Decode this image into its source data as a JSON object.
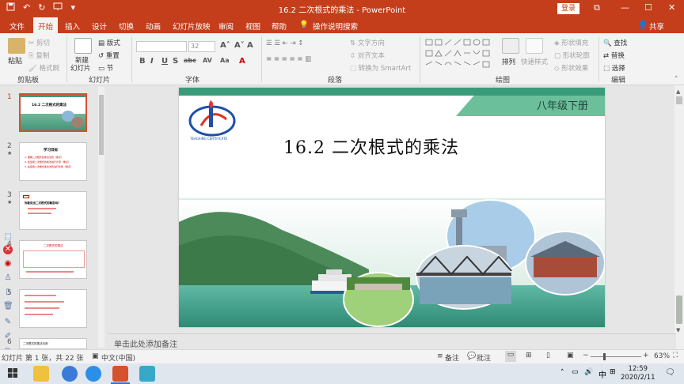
{
  "titlebar": {
    "doc_title": "16.2 二次根式的乘法 - PowerPoint",
    "login_label": "登录",
    "qat_undo": "↶",
    "qat_redo": "↻",
    "win_restore": "⧉",
    "win_minimize": "—",
    "win_maximize": "☐",
    "win_close": "✕"
  },
  "tabs": [
    {
      "label": "文件"
    },
    {
      "label": "开始"
    },
    {
      "label": "插入"
    },
    {
      "label": "设计"
    },
    {
      "label": "切换"
    },
    {
      "label": "动画"
    },
    {
      "label": "幻灯片放映"
    },
    {
      "label": "审阅"
    },
    {
      "label": "视图"
    },
    {
      "label": "帮助"
    },
    {
      "label": "操作说明搜索"
    }
  ],
  "share_label": "共享",
  "ribbon": {
    "clipboard": {
      "paste": "粘贴",
      "cut": "剪切",
      "copy": "复制",
      "format_painter": "格式刷",
      "group": "剪贴板"
    },
    "slides": {
      "new_slide_1": "新建",
      "new_slide_2": "幻灯片",
      "layout": "版式",
      "reset": "重置",
      "section": "节",
      "group": "幻灯片"
    },
    "font": {
      "size": "32",
      "bold": "B",
      "italic": "I",
      "underline": "U",
      "strike": "S",
      "shadow": "abc",
      "spacing": "AV",
      "case": "Aa",
      "clear": "A",
      "color": "A",
      "group": "字体"
    },
    "paragraph": {
      "text_direction": "文字方向",
      "align_text": "对齐文本",
      "smartart": "转换为 SmartArt",
      "group": "段落"
    },
    "drawing": {
      "arrange": "排列",
      "quick_styles": "快速样式",
      "shape_fill": "形状填充",
      "shape_outline": "形状轮廓",
      "shape_effects": "形状效果",
      "group": "绘图"
    },
    "editing": {
      "find": "查找",
      "replace": "替换",
      "select": "选择",
      "group": "编辑"
    }
  },
  "thumbnails": [
    {
      "num": "1",
      "title": "16.2 二次根式的乘法"
    },
    {
      "num": "2",
      "title": "学习目标",
      "lines": [
        "1. 理解二次根式的乘法法则（重点）",
        "2. 会运用二次根式的乘法进行计算（重点）",
        "3. 会运用二次根式乘法法则进行化简（难点）"
      ]
    },
    {
      "num": "3",
      "title": "你能说出二次根式的概念吗?"
    },
    {
      "num": "4",
      "title": "二次根式的乘法"
    },
    {
      "num": "5",
      "title": ""
    },
    {
      "num": "6",
      "title": "二次根式的乘法法则"
    }
  ],
  "slide": {
    "grade": "八年级下册",
    "title": "16.2  二次根式的乘法"
  },
  "notes_placeholder": "单击此处添加备注",
  "status": {
    "slide_count": "幻灯片 第 1 张，共 22 张",
    "language": "中文(中国)",
    "notes_btn": "备注",
    "comments_btn": "批注",
    "zoom_level": "63%",
    "zoom_minus": "−",
    "zoom_plus": "+"
  },
  "taskbar": {
    "time": "12:59",
    "date": "2020/2/11",
    "ime": "中"
  },
  "colors": {
    "accent": "#c43e1c",
    "slide_band": "#3a9b7a"
  }
}
